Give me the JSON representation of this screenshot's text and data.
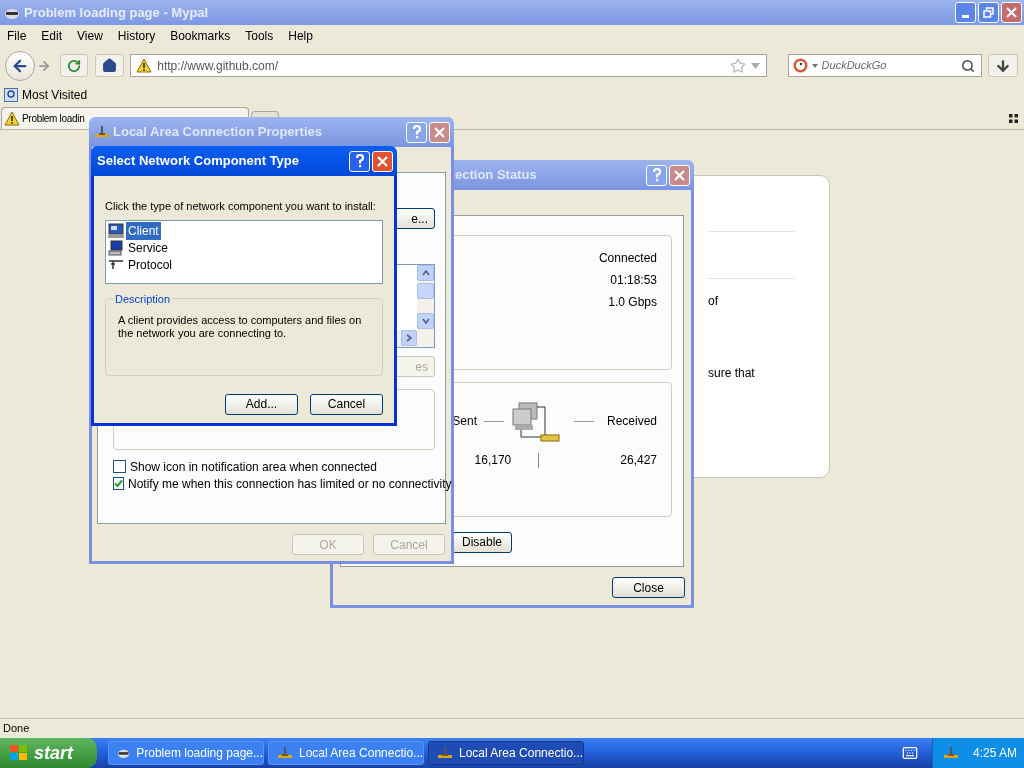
{
  "browser": {
    "title": "Problem loading page - Mypal",
    "menu": [
      "File",
      "Edit",
      "View",
      "History",
      "Bookmarks",
      "Tools",
      "Help"
    ],
    "url": "http://www.github.com/",
    "search": {
      "placeholder": "DuckDuckGo"
    },
    "bookmarks": [
      "Most Visited"
    ],
    "tabs": [
      {
        "label": "Problem loadin",
        "selected": true
      }
    ],
    "status_bar": "Done"
  },
  "error_page": {
    "lines": [
      "of",
      "sure that"
    ]
  },
  "status_window": {
    "title": "ection Status",
    "connection": [
      "Connected",
      "01:18:53",
      "1.0 Gbps"
    ],
    "activity": {
      "sent_label": "Sent",
      "received_label": "Received",
      "sent": "16,170",
      "received": "26,427"
    },
    "buttons": [
      {
        "label": "Disable",
        "disabled": false
      },
      {
        "label": "Close",
        "disabled": false
      }
    ]
  },
  "properties_window": {
    "title": "Local Area Connection Properties",
    "configure_button": {
      "label": "e...",
      "disabled": false
    },
    "properties_button": {
      "label": "es",
      "disabled": true
    },
    "checkboxes": [
      {
        "label": "Show icon in notification area when connected",
        "checked": false
      },
      {
        "label": "Notify me when this connection has limited or no connectivity",
        "checked": true
      }
    ],
    "buttons": [
      {
        "label": "OK",
        "disabled": true
      },
      {
        "label": "Cancel",
        "disabled": true
      }
    ]
  },
  "component_dialog": {
    "title": "Select Network Component Type",
    "prompt": "Click the type of network component you want to install:",
    "components": [
      {
        "label": "Client",
        "kind": "client",
        "selected": true
      },
      {
        "label": "Service",
        "kind": "service",
        "selected": false
      },
      {
        "label": "Protocol",
        "kind": "protocol",
        "selected": false
      }
    ],
    "description_label": "Description",
    "description": "A client provides access to computers and files on the network you are connecting to.",
    "buttons": [
      {
        "label": "Add...",
        "disabled": false
      },
      {
        "label": "Cancel",
        "disabled": false
      }
    ]
  },
  "taskbar": {
    "start": "start",
    "tasks": [
      {
        "label": "Problem loading page...",
        "kind": "browser",
        "selected": false
      },
      {
        "label": "Local Area Connectio...",
        "kind": "network",
        "selected": false
      },
      {
        "label": "Local Area Connectio...",
        "kind": "network",
        "selected": true
      }
    ],
    "clock": "4:25 AM"
  }
}
